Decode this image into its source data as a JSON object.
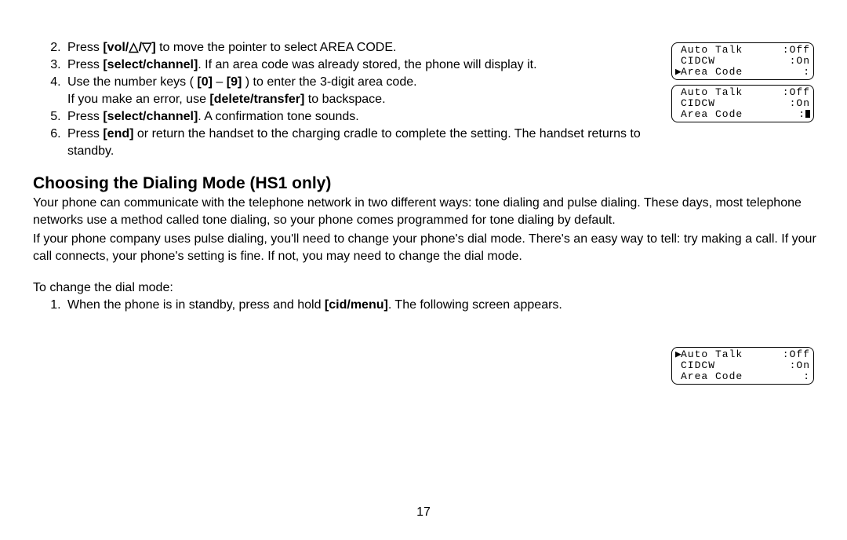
{
  "steps_top": {
    "start": 2,
    "items": [
      {
        "pre": "Press ",
        "bold": "vol/",
        "mid_icons": "△/▽",
        "bold2": "]",
        "post": " to move the pointer to select AREA CODE."
      },
      {
        "pre": "Press ",
        "bold": "select/channel",
        "post": ". If an area code was already stored, the phone will display it."
      },
      {
        "pre": "Use the number keys ( ",
        "bold": "[0]",
        "mid": " – ",
        "bold2": "[9]",
        "post": " ) to enter the 3-digit area code.",
        "cont": "If you make an error, use ",
        "cont_bold": "delete/transfer",
        "cont_post": " to backspace."
      },
      {
        "pre": "Press ",
        "bold": "select/channel",
        "post": ". A confirmation tone sounds."
      },
      {
        "pre": "Press ",
        "bold": "end",
        "post": " or return the handset to the charging cradle to complete the setting. The handset returns to standby."
      }
    ]
  },
  "section_heading": "Choosing the Dialing Mode (HS1 only)",
  "para1": "Your phone can communicate with the telephone network in two different ways: tone dialing and pulse dialing. These days, most telephone networks use a method called tone dialing, so your phone comes programmed for tone dialing by default.",
  "para2": "If your phone company uses pulse dialing, you'll need to change your phone's dial mode. There's an easy way to tell: try making a call. If your call connects, your phone's setting is fine. If not, you may need to change the dial mode.",
  "para3": "To change the dial mode:",
  "steps_bottom": {
    "start": 1,
    "items": [
      {
        "pre": "When the phone is in standby, press and hold ",
        "bold": "cid/menu",
        "post": ". The following screen appears."
      }
    ]
  },
  "lcd1": {
    "rows": [
      {
        "ptr": " ",
        "left": "Auto Talk",
        "right": ":Off"
      },
      {
        "ptr": " ",
        "left": "CIDCW",
        "right": ":On"
      },
      {
        "ptr": "▶",
        "left": "Area Code",
        "right": ":"
      }
    ]
  },
  "lcd2": {
    "rows": [
      {
        "ptr": " ",
        "left": "Auto Talk",
        "right": ":Off"
      },
      {
        "ptr": " ",
        "left": "CIDCW",
        "right": ":On"
      },
      {
        "ptr": " ",
        "left": "Area Code",
        "right": ":",
        "cursor": true
      }
    ]
  },
  "lcd3": {
    "rows": [
      {
        "ptr": "▶",
        "left": "Auto Talk",
        "right": ":Off"
      },
      {
        "ptr": " ",
        "left": "CIDCW",
        "right": ":On"
      },
      {
        "ptr": " ",
        "left": "Area Code",
        "right": ":"
      }
    ]
  },
  "page_number": "17",
  "labels": {
    "vol_prefix": "vol",
    "bracket_open": "[",
    "bracket_close": "]"
  }
}
